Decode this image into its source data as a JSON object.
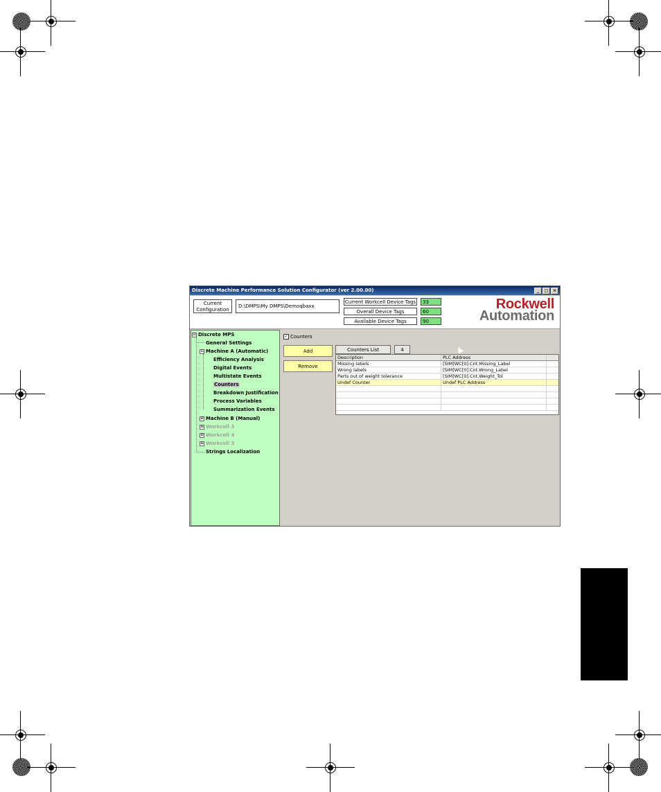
{
  "window": {
    "title": "Discrete Machine Performance Solution Configurator (ver 2.00.00)",
    "buttons": [
      "_",
      "□",
      "×"
    ]
  },
  "config": {
    "label": "Current\nConfiguration",
    "path": "D:\\DMPS\\My DMPS\\Demoqbaxx"
  },
  "tags": [
    {
      "label": "Current Workcell Device Tags",
      "value": "33"
    },
    {
      "label": "Overall Device Tags",
      "value": "60"
    },
    {
      "label": "Available Device Tags",
      "value": "90"
    }
  ],
  "logo": {
    "line1": "Rockwell",
    "line2": "Automation"
  },
  "tree": {
    "items": [
      {
        "label": "Discrete MPS",
        "expander": "⊟",
        "disabled": false,
        "selected": false
      },
      {
        "label": "General Settings",
        "disabled": false,
        "selected": false
      },
      {
        "label": "Machine A (Automatic)",
        "expander": "⊟",
        "disabled": false,
        "selected": false
      },
      {
        "label": "Efficiency Analysis",
        "disabled": false,
        "selected": false
      },
      {
        "label": "Digital Events",
        "disabled": false,
        "selected": false
      },
      {
        "label": "Multistate Events",
        "disabled": false,
        "selected": false
      },
      {
        "label": "Counters",
        "disabled": false,
        "selected": true
      },
      {
        "label": "Breakdown Justification",
        "disabled": false,
        "selected": false
      },
      {
        "label": "Process Variables",
        "disabled": false,
        "selected": false
      },
      {
        "label": "Summarization Events",
        "disabled": false,
        "selected": false
      },
      {
        "label": "Machine B (Manual)",
        "expander": "⊞",
        "disabled": false,
        "selected": false
      },
      {
        "label": "Workcell 3",
        "expander": "⊞",
        "disabled": true,
        "selected": false
      },
      {
        "label": "Workcell 4",
        "expander": "⊞",
        "disabled": true,
        "selected": false
      },
      {
        "label": "Workcell 5",
        "expander": "⊞",
        "disabled": true,
        "selected": false
      },
      {
        "label": "Strings Localization",
        "disabled": false,
        "selected": false
      }
    ]
  },
  "counters": {
    "checkbox_label": "Counters",
    "checkbox_checked": true,
    "add_label": "Add",
    "remove_label": "Remove",
    "list_title": "Counters List",
    "list_count": "4",
    "columns": [
      "Description",
      "PLC Address"
    ],
    "rows": [
      {
        "description": "Missing labels",
        "plc": "[SIM]WC[0].Cnt.Missing_Label"
      },
      {
        "description": "Wrong labels",
        "plc": "[SIM]WC[0].Cnt.Wrong_Label"
      },
      {
        "description": "Parts out of weight tolerance",
        "plc": "[SIM]WC[0].Cnt.Weight_Tol"
      },
      {
        "description": "Undef Counter",
        "plc": "Undef PLC Address"
      }
    ]
  },
  "colors": {
    "tree_bg": "#bfffbf",
    "tag_value_bg": "#7ee07e",
    "button_yellow": "#ffffa8",
    "logo_red": "#b22028"
  }
}
